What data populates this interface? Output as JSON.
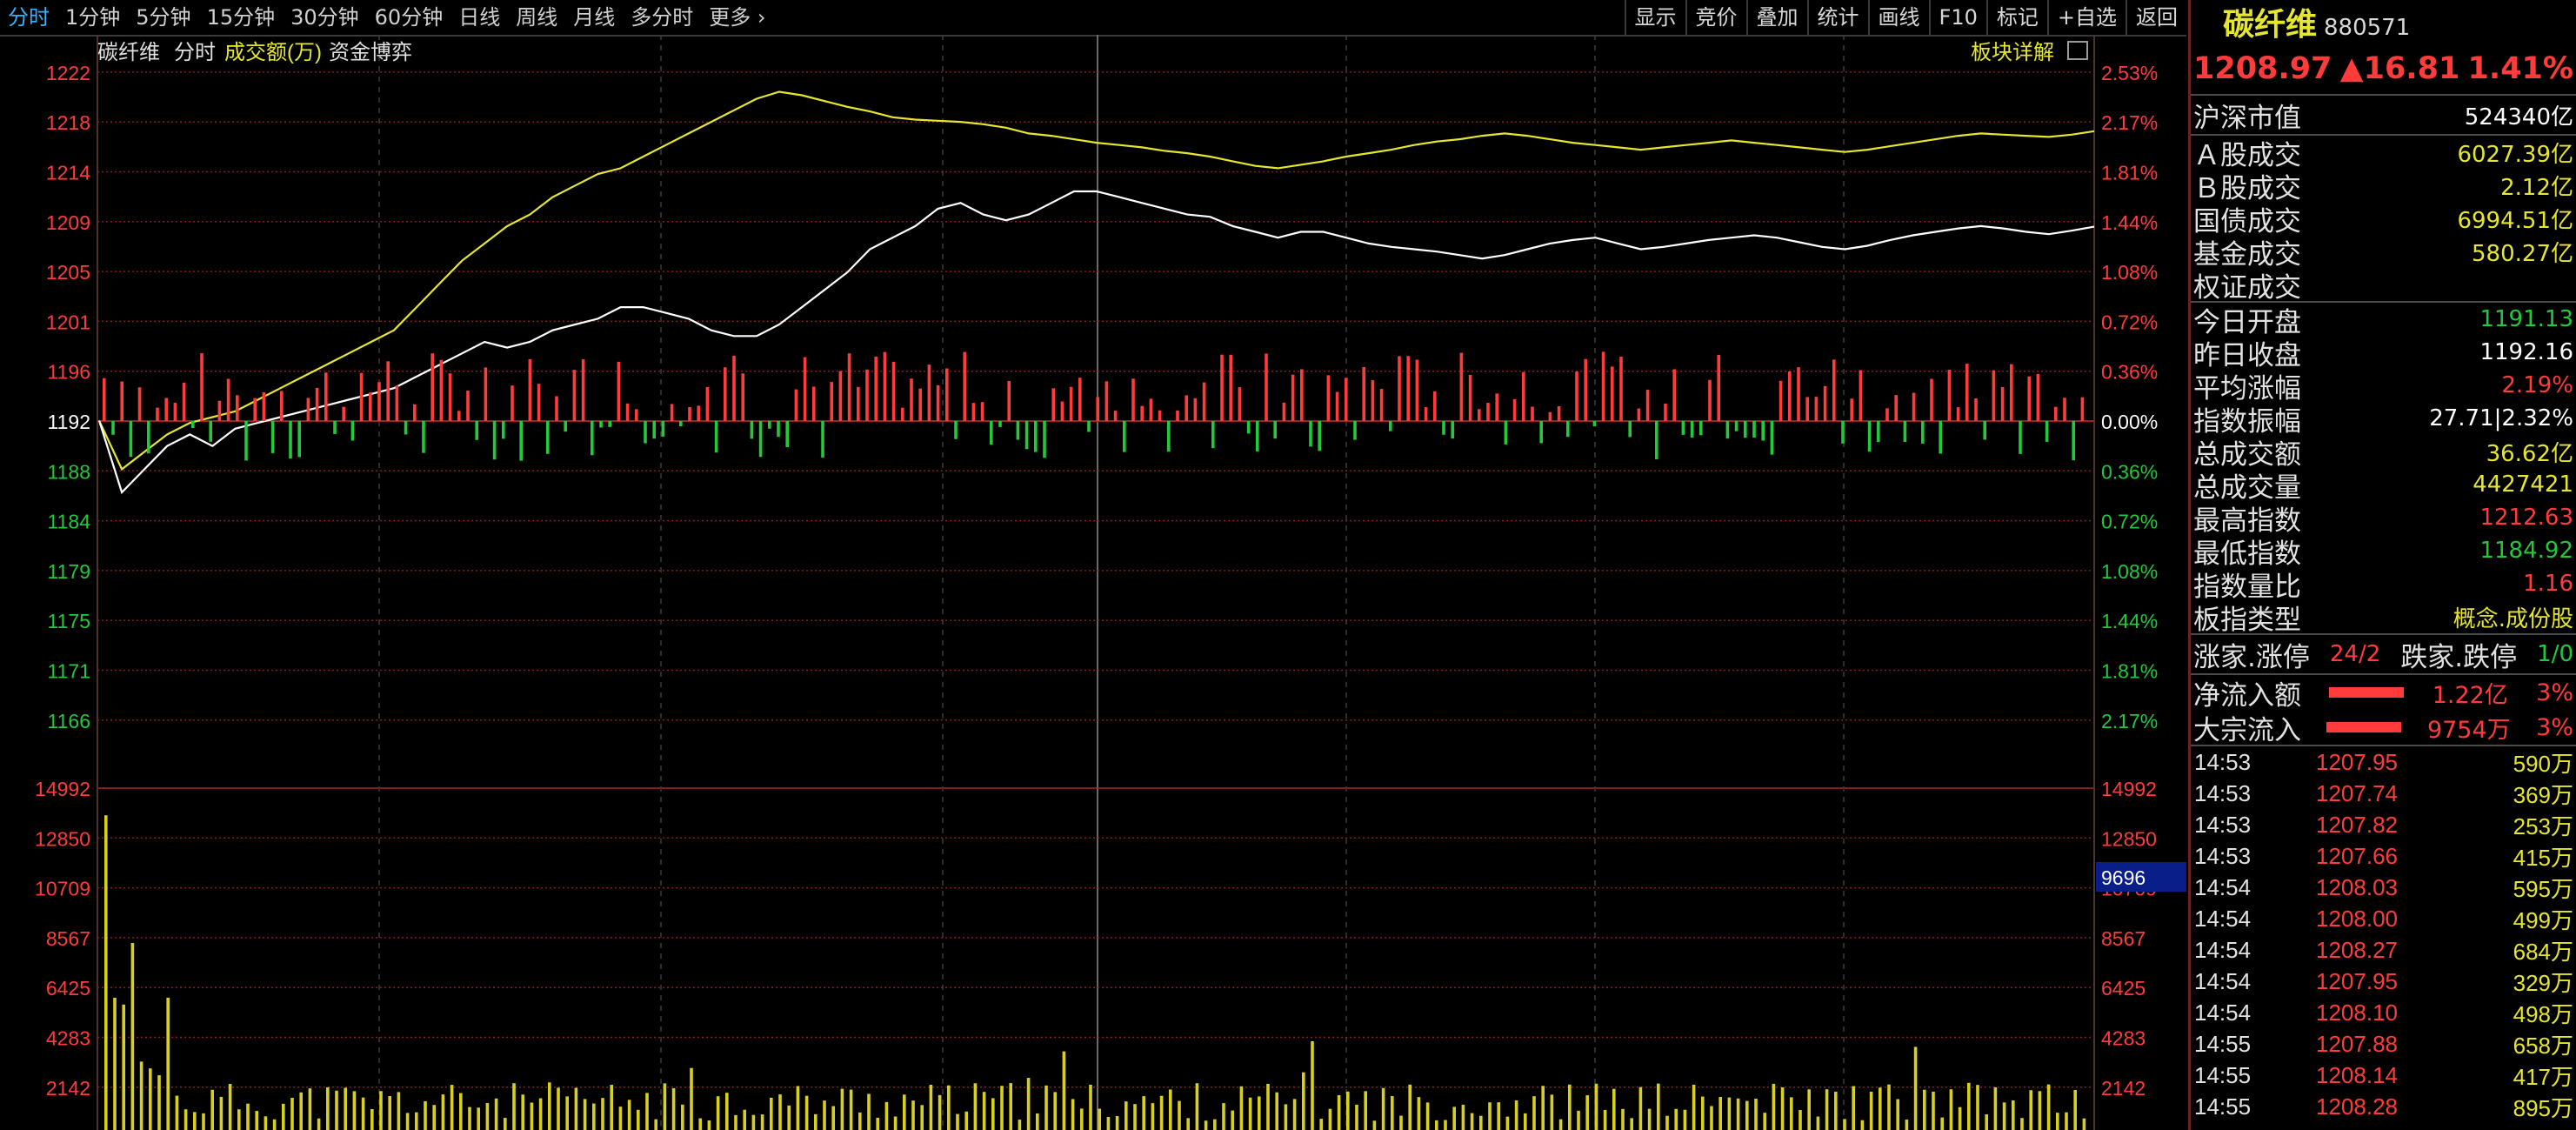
{
  "toolbar": {
    "tabs": [
      {
        "label": "分时",
        "active": true
      },
      {
        "label": "1分钟"
      },
      {
        "label": "5分钟"
      },
      {
        "label": "15分钟"
      },
      {
        "label": "30分钟"
      },
      {
        "label": "60分钟"
      },
      {
        "label": "日线"
      },
      {
        "label": "周线"
      },
      {
        "label": "月线"
      },
      {
        "label": "多分时"
      },
      {
        "label": "更多"
      }
    ],
    "buttons": [
      "显示",
      "竞价",
      "叠加",
      "统计",
      "画线",
      "F10",
      "标记",
      "+自选",
      "返回"
    ]
  },
  "chart_header": {
    "name": "碳纤维",
    "mode": "分时",
    "indicator": "成交额(万)",
    "fund": "资金博弈",
    "detail": "板块详解"
  },
  "price_axis": {
    "left_up": [
      "1222",
      "1218",
      "1214",
      "1209",
      "1205",
      "1201",
      "1196"
    ],
    "mid": "1192",
    "left_down": [
      "1188",
      "1184",
      "1179",
      "1175",
      "1171",
      "1166"
    ],
    "pct_up": [
      "2.53%",
      "2.17%",
      "1.81%",
      "1.44%",
      "1.08%",
      "0.72%",
      "0.36%"
    ],
    "pct_mid": "0.00%",
    "pct_down": [
      "0.36%",
      "0.72%",
      "1.08%",
      "1.44%",
      "1.81%",
      "2.17%"
    ]
  },
  "volume_axis": [
    "14992",
    "12850",
    "10709",
    "8567",
    "6425",
    "4283",
    "2142"
  ],
  "volume_cursor": "9696",
  "colors": {
    "up": "#ff3b3b",
    "down": "#22c93a",
    "yellow": "#e6e62e",
    "white": "#ffffff",
    "blue_cursor": "#0a1e8a"
  },
  "chart_data": {
    "type": "line",
    "x": "trading minutes 09:30–15:00",
    "prev_close": 1192.16,
    "y_range": [
      1162.0,
      1222.3
    ],
    "price_series": [
      1192.2,
      1186,
      1188,
      1190,
      1191,
      1190,
      1191.5,
      1192,
      1192.5,
      1193,
      1193.5,
      1194,
      1194.5,
      1195,
      1196,
      1197,
      1198,
      1199,
      1198.5,
      1199,
      1200,
      1200.5,
      1201,
      1202,
      1202,
      1201.5,
      1201,
      1200,
      1199.5,
      1199.5,
      1200.5,
      1202,
      1203.5,
      1205,
      1207,
      1208,
      1209,
      1210.5,
      1211,
      1210,
      1209.5,
      1210,
      1211,
      1212,
      1212,
      1211.5,
      1211,
      1210.5,
      1210,
      1209.8,
      1209,
      1208.5,
      1208,
      1208.5,
      1208.5,
      1208,
      1207.5,
      1207.2,
      1207,
      1206.8,
      1206.5,
      1206.2,
      1206.5,
      1207,
      1207.5,
      1207.8,
      1208,
      1207.5,
      1207,
      1207.2,
      1207.5,
      1207.8,
      1208,
      1208.2,
      1208,
      1207.6,
      1207.2,
      1207,
      1207.3,
      1207.8,
      1208.2,
      1208.5,
      1208.8,
      1209,
      1208.8,
      1208.5,
      1208.3,
      1208.6,
      1208.95
    ],
    "avg_series": [
      1192.2,
      1188,
      1189.5,
      1191,
      1192,
      1192.5,
      1193,
      1194,
      1195,
      1196,
      1197,
      1198,
      1199,
      1200,
      1202,
      1204,
      1206,
      1207.5,
      1209,
      1210,
      1211.5,
      1212.5,
      1213.5,
      1214,
      1215,
      1216,
      1217,
      1218,
      1219,
      1220,
      1220.6,
      1220.3,
      1219.8,
      1219.3,
      1218.9,
      1218.4,
      1218.2,
      1218.1,
      1218,
      1217.8,
      1217.5,
      1217,
      1216.8,
      1216.5,
      1216.2,
      1216,
      1215.8,
      1215.5,
      1215.3,
      1215,
      1214.6,
      1214.2,
      1214,
      1214.3,
      1214.6,
      1215,
      1215.3,
      1215.6,
      1216,
      1216.3,
      1216.5,
      1216.8,
      1217,
      1216.8,
      1216.5,
      1216.2,
      1216,
      1215.8,
      1215.6,
      1215.8,
      1216,
      1216.2,
      1216.4,
      1216.2,
      1216,
      1215.8,
      1215.6,
      1215.4,
      1215.6,
      1215.9,
      1216.2,
      1216.5,
      1216.8,
      1217,
      1216.9,
      1216.8,
      1216.7,
      1216.9,
      1217.2
    ],
    "volume_ymax": 14992,
    "pressure_scale": "0.36%"
  },
  "side": {
    "name": "碳纤维",
    "code": "880571",
    "price": "1208.97",
    "change": "▲16.81",
    "pct": "1.41%",
    "market": {
      "label": "沪深市值",
      "value": "524340亿"
    },
    "stats1": [
      {
        "label": "Ａ股成交",
        "value": "6027.39亿"
      },
      {
        "label": "Ｂ股成交",
        "value": "2.12亿"
      },
      {
        "label": "国债成交",
        "value": "6994.51亿"
      },
      {
        "label": "基金成交",
        "value": "580.27亿"
      },
      {
        "label": "权证成交",
        "value": ""
      }
    ],
    "stats2": [
      {
        "label": "今日开盘",
        "value": "1191.13",
        "color": "#22c93a"
      },
      {
        "label": "昨日收盘",
        "value": "1192.16",
        "color": "#ffffff"
      },
      {
        "label": "平均涨幅",
        "value": "2.19%",
        "color": "#ff3b3b"
      },
      {
        "label": "指数振幅",
        "value": "27.71|2.32%",
        "color": "#ffffff"
      },
      {
        "label": "总成交额",
        "value": "36.62亿",
        "color": "#e6e62e"
      },
      {
        "label": "总成交量",
        "value": "4427421",
        "color": "#e6e62e"
      },
      {
        "label": "最高指数",
        "value": "1212.63",
        "color": "#ff3b3b"
      },
      {
        "label": "最低指数",
        "value": "1184.92",
        "color": "#22c93a"
      },
      {
        "label": "指数量比",
        "value": "1.16",
        "color": "#ff3b3b"
      },
      {
        "label": "板指类型",
        "value": "概念.成份股",
        "color": "#e6e62e"
      }
    ],
    "breadth": {
      "up_label": "涨家.涨停",
      "up_value": "24/2",
      "down_label": "跌家.跌停",
      "down_value": "1/0"
    },
    "flows": [
      {
        "label": "净流入额",
        "value": "1.22亿",
        "pct": "3%"
      },
      {
        "label": "大宗流入",
        "value": "9754万",
        "pct": "3%"
      }
    ],
    "ticks": [
      {
        "time": "14:53",
        "price": "1207.95",
        "vol": "590万"
      },
      {
        "time": "14:53",
        "price": "1207.74",
        "vol": "369万"
      },
      {
        "time": "14:53",
        "price": "1207.82",
        "vol": "253万"
      },
      {
        "time": "14:53",
        "price": "1207.66",
        "vol": "415万"
      },
      {
        "time": "14:54",
        "price": "1208.03",
        "vol": "595万"
      },
      {
        "time": "14:54",
        "price": "1208.00",
        "vol": "499万"
      },
      {
        "time": "14:54",
        "price": "1208.27",
        "vol": "684万"
      },
      {
        "time": "14:54",
        "price": "1207.95",
        "vol": "329万"
      },
      {
        "time": "14:54",
        "price": "1208.10",
        "vol": "498万"
      },
      {
        "time": "14:55",
        "price": "1207.88",
        "vol": "658万"
      },
      {
        "time": "14:55",
        "price": "1208.14",
        "vol": "417万"
      },
      {
        "time": "14:55",
        "price": "1208.28",
        "vol": "895万"
      }
    ]
  }
}
